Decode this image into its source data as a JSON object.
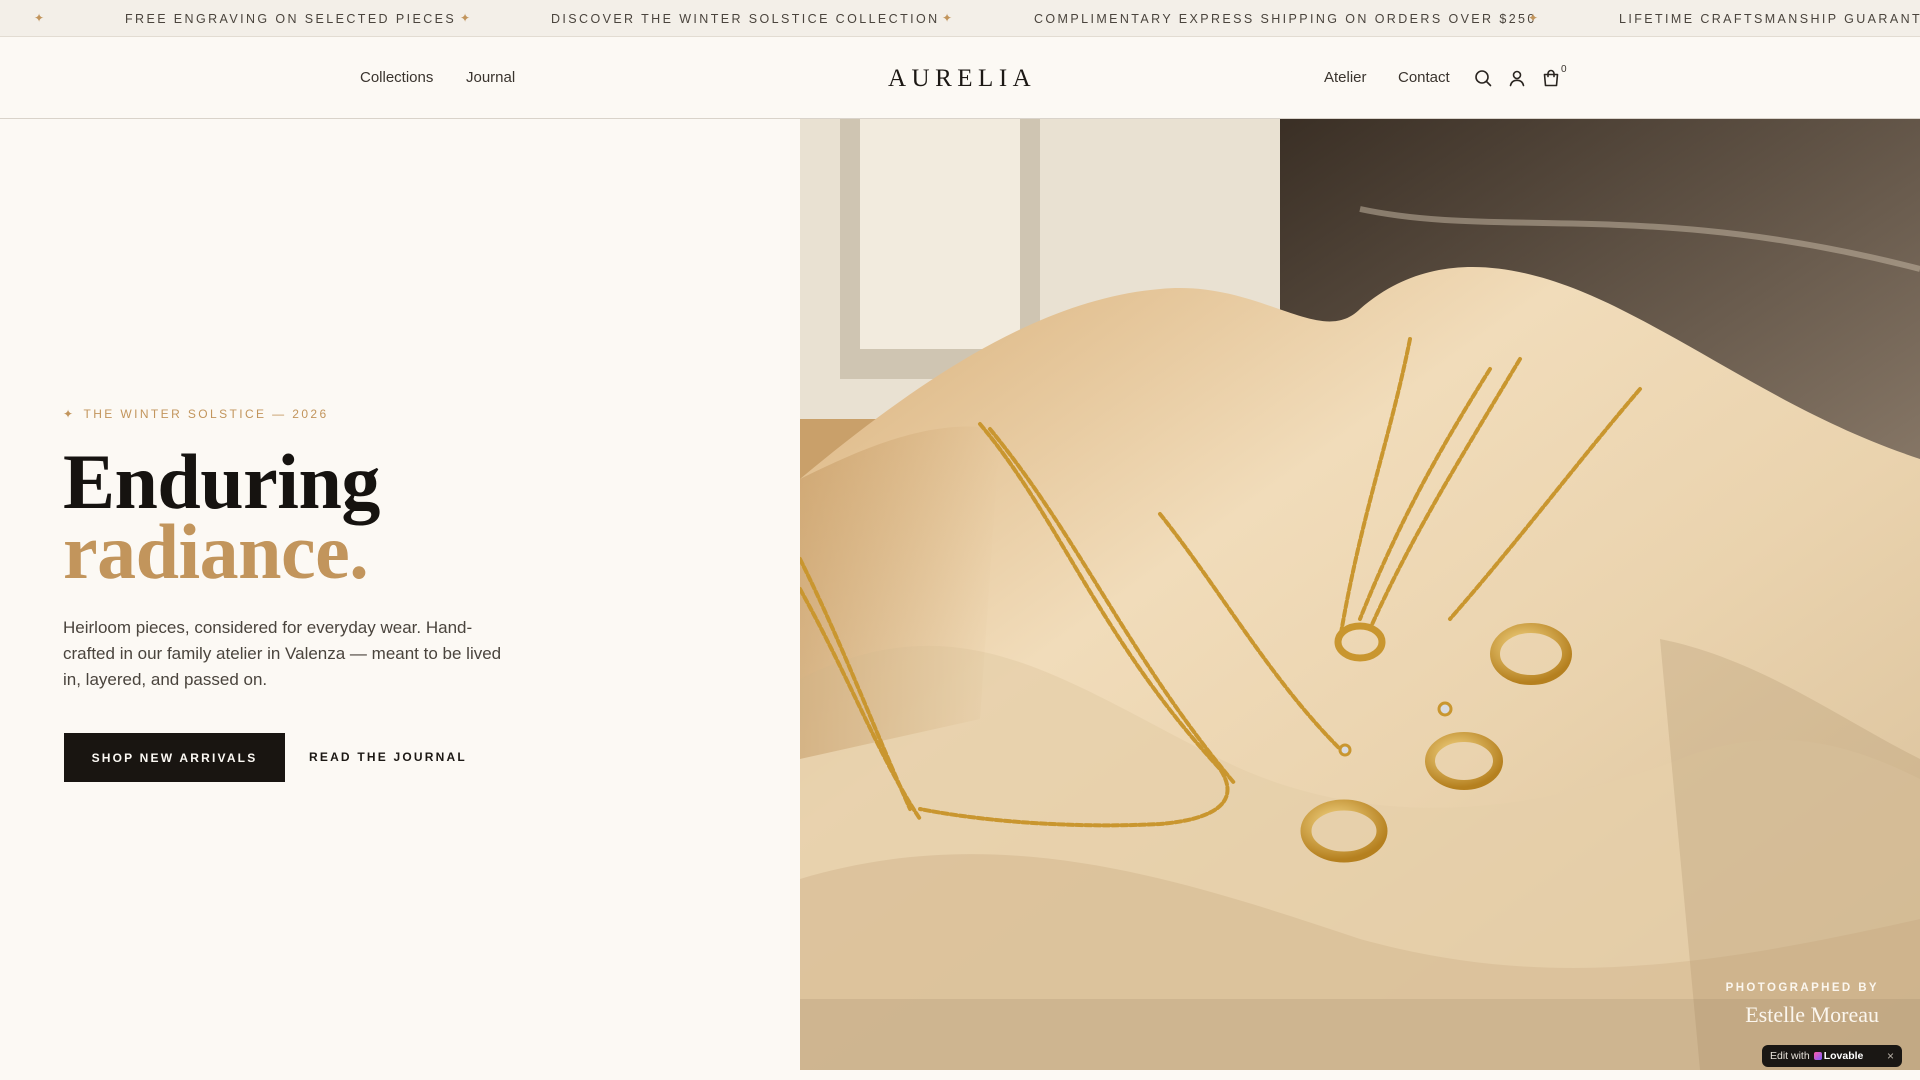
{
  "announcement": {
    "star_glyph": "✦",
    "messages": [
      "FREE ENGRAVING ON SELECTED PIECES",
      "DISCOVER THE WINTER SOLSTICE COLLECTION",
      "COMPLIMENTARY EXPRESS SHIPPING ON ORDERS OVER $250",
      "LIFETIME CRAFTSMANSHIP GUARANTEE"
    ]
  },
  "header": {
    "nav_left": [
      "Collections",
      "Journal"
    ],
    "logo": "AURELIA",
    "nav_right": [
      "Atelier",
      "Contact"
    ],
    "icons": [
      "search-icon",
      "account-icon",
      "cart-icon"
    ],
    "cart_count": "0"
  },
  "hero": {
    "eyebrow_glyph": "✦",
    "eyebrow": "THE WINTER SOLSTICE — 2026",
    "headline_main": "Enduring",
    "headline_accent": "radiance.",
    "lead": "Heirloom pieces, considered for everyday wear. Hand-crafted in our family atelier in Valenza — meant to be lived in, layered, and passed on.",
    "primary_cta": "SHOP NEW ARRIVALS",
    "secondary_cta": "READ THE JOURNAL",
    "photo_credit_label": "PHOTOGRAPHED BY",
    "photo_credit_name": "Estelle Moreau"
  },
  "badge": {
    "prefix": "Edit with",
    "brand": "Lovable",
    "close": "×"
  },
  "colors": {
    "background": "#fcf9f4",
    "accent_gold": "#c2955c",
    "ink": "#191511"
  }
}
